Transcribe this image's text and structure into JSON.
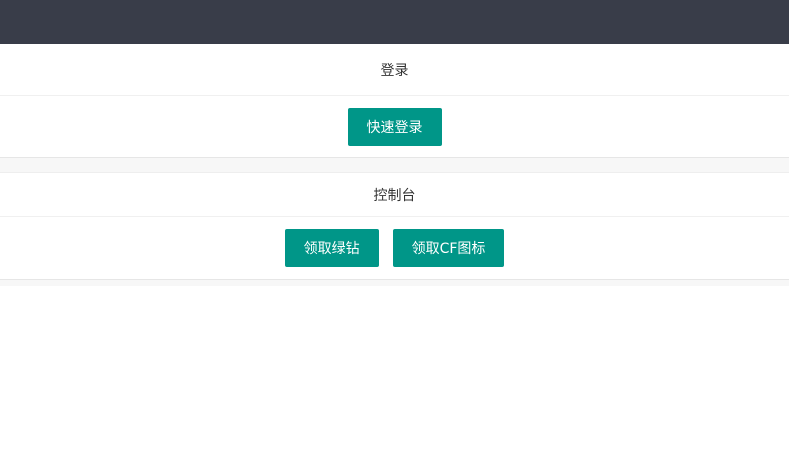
{
  "login_panel": {
    "title": "登录",
    "quick_login_label": "快速登录"
  },
  "console_panel": {
    "title": "控制台",
    "claim_green_diamond_label": "领取绿钻",
    "claim_cf_icon_label": "领取CF图标"
  },
  "colors": {
    "topbar": "#393d49",
    "button": "#009688",
    "separator": "#f7f7f7"
  }
}
